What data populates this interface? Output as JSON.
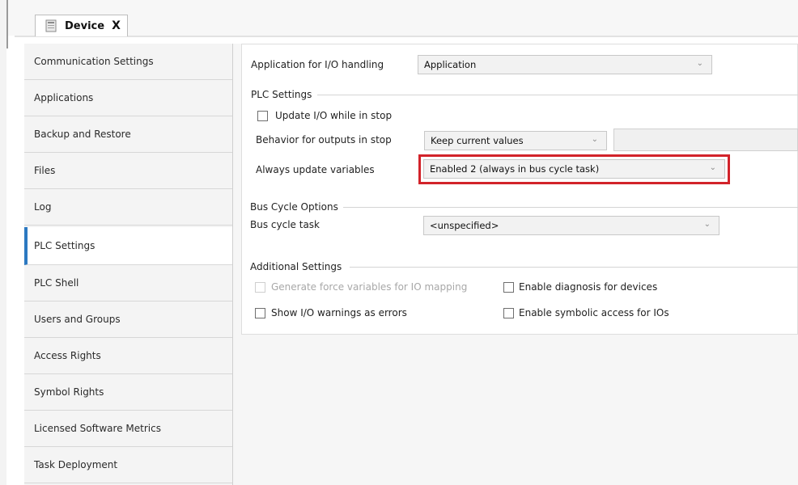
{
  "tab": {
    "label": "Device",
    "close": "X"
  },
  "nav": {
    "items": [
      {
        "label": "Communication Settings"
      },
      {
        "label": "Applications"
      },
      {
        "label": "Backup and Restore"
      },
      {
        "label": "Files"
      },
      {
        "label": "Log"
      },
      {
        "label": "PLC Settings"
      },
      {
        "label": "PLC Shell"
      },
      {
        "label": "Users and Groups"
      },
      {
        "label": "Access Rights"
      },
      {
        "label": "Symbol Rights"
      },
      {
        "label": "Licensed Software Metrics"
      },
      {
        "label": "Task Deployment"
      }
    ],
    "selected": "PLC Settings"
  },
  "app_io": {
    "label": "Application for I/O handling",
    "value": "Application"
  },
  "plc_settings": {
    "group_label": "PLC Settings",
    "update_io_label": "Update I/O while in stop",
    "update_io_checked": false,
    "outputs_label": "Behavior for outputs in stop",
    "outputs_value": "Keep current values",
    "always_update_label": "Always update variables",
    "always_update_value": "Enabled 2 (always in bus cycle task)"
  },
  "bus_cycle": {
    "group_label": "Bus Cycle Options",
    "task_label": "Bus cycle task",
    "task_value": "<unspecified>"
  },
  "additional": {
    "group_label": "Additional Settings",
    "force_vars_label": "Generate force variables for IO mapping",
    "force_vars_enabled": false,
    "diag_label": "Enable diagnosis for devices",
    "warnings_label": "Show I/O warnings as errors",
    "symbolic_label": "Enable symbolic access for IOs"
  },
  "colors": {
    "highlight": "#d2232a",
    "selected_accent": "#2c79c1"
  },
  "icons": {
    "tab": "device-icon",
    "dropdown": "chevron-down-icon"
  }
}
